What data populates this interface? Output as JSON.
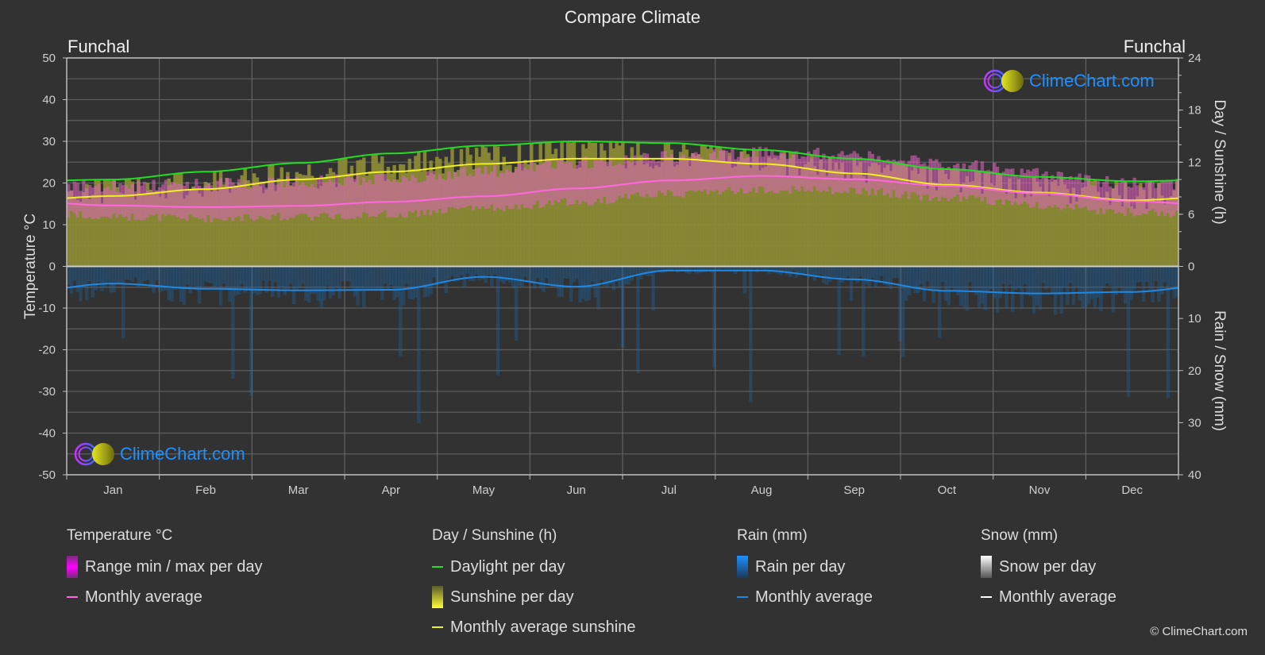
{
  "title": "Compare Climate",
  "location_left": "Funchal",
  "location_right": "Funchal",
  "logo_text": "ClimeChart.com",
  "copyright": "© ClimeChart.com",
  "chart_data": {
    "type": "line",
    "title": "Compare Climate",
    "categories": [
      "Jan",
      "Feb",
      "Mar",
      "Apr",
      "May",
      "Jun",
      "Jul",
      "Aug",
      "Sep",
      "Oct",
      "Nov",
      "Dec"
    ],
    "left_axis": {
      "label": "Temperature °C",
      "range": [
        -50,
        50
      ],
      "ticks": [
        50,
        40,
        30,
        20,
        10,
        0,
        -10,
        -20,
        -30,
        -40,
        -50
      ]
    },
    "right_axis_top": {
      "label": "Day / Sunshine (h)",
      "range": [
        0,
        24
      ],
      "ticks": [
        24,
        18,
        12,
        6,
        0
      ]
    },
    "right_axis_bottom": {
      "label": "Rain / Snow (mm)",
      "range": [
        0,
        40
      ],
      "ticks": [
        0,
        10,
        20,
        30,
        40
      ]
    },
    "grid": true,
    "series": [
      {
        "name": "Daylight per day",
        "unit": "h",
        "axis": "sunshine",
        "color": "#22dd22",
        "values": [
          10.0,
          10.9,
          11.9,
          13.0,
          13.9,
          14.4,
          14.2,
          13.4,
          12.4,
          11.2,
          10.3,
          9.8
        ]
      },
      {
        "name": "Monthly average sunshine",
        "unit": "h",
        "axis": "sunshine",
        "color": "#f0f020",
        "values": [
          8.1,
          8.9,
          10.0,
          10.9,
          11.8,
          12.4,
          12.4,
          11.8,
          10.7,
          9.4,
          8.5,
          7.6
        ]
      },
      {
        "name": "Temperature monthly average",
        "unit": "°C",
        "axis": "temperature",
        "color": "#ff66e0",
        "values": [
          14.6,
          14.2,
          14.5,
          15.5,
          16.8,
          18.7,
          20.6,
          21.7,
          20.9,
          19.3,
          17.5,
          15.6
        ]
      },
      {
        "name": "Temperature range max",
        "unit": "°C",
        "axis": "temperature",
        "color": "#c040c0",
        "values": [
          19,
          19.5,
          20,
          21,
          22.5,
          24.5,
          26,
          27,
          26.5,
          24.5,
          22,
          19.5
        ]
      },
      {
        "name": "Temperature range min",
        "unit": "°C",
        "axis": "temperature",
        "color": "#c040c0",
        "values": [
          12,
          11.5,
          12,
          12.5,
          14,
          15.5,
          17.5,
          18.5,
          18,
          16.5,
          14.5,
          13
        ]
      },
      {
        "name": "Rain monthly average",
        "unit": "mm",
        "axis": "rain",
        "color": "#1e88e5",
        "values": [
          3.3,
          4.3,
          4.6,
          4.5,
          2.0,
          3.9,
          0.8,
          0.8,
          2.5,
          4.7,
          5.2,
          4.9
        ]
      },
      {
        "name": "Snow monthly average",
        "unit": "mm",
        "axis": "rain",
        "color": "#ffffff",
        "values": [
          0,
          0,
          0,
          0,
          0,
          0,
          0,
          0,
          0,
          0,
          0,
          0
        ]
      }
    ]
  },
  "legend": {
    "temperature": {
      "title": "Temperature °C",
      "items": [
        "Range min / max per day",
        "Monthly average"
      ]
    },
    "sunshine": {
      "title": "Day / Sunshine (h)",
      "items": [
        "Daylight per day",
        "Sunshine per day",
        "Monthly average sunshine"
      ]
    },
    "rain": {
      "title": "Rain (mm)",
      "items": [
        "Rain per day",
        "Monthly average"
      ]
    },
    "snow": {
      "title": "Snow (mm)",
      "items": [
        "Snow per day",
        "Monthly average"
      ]
    }
  }
}
